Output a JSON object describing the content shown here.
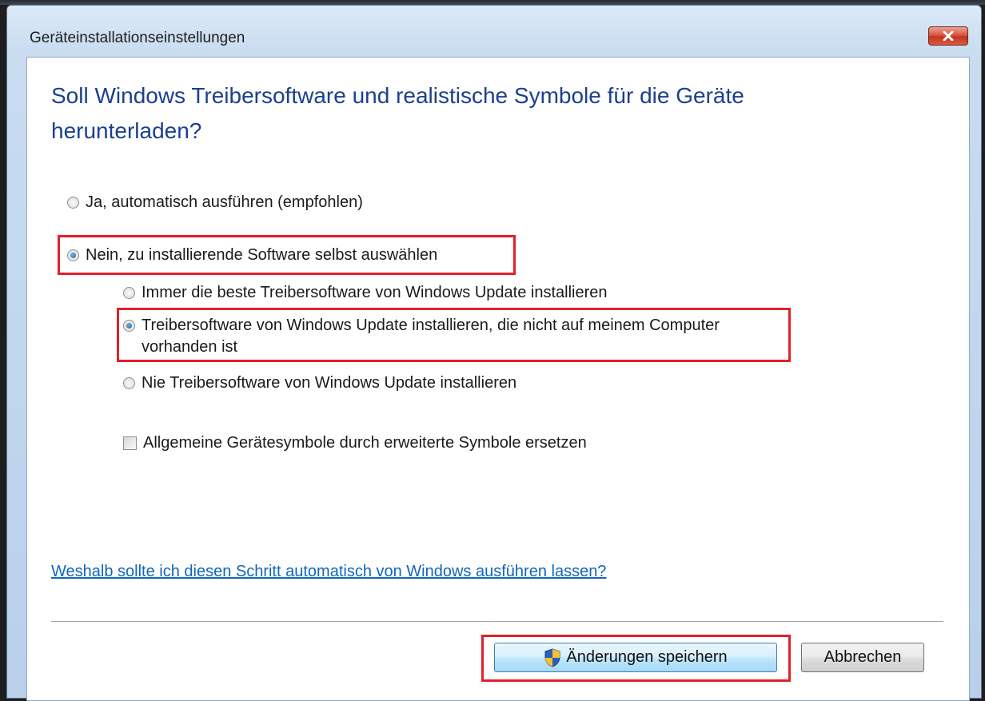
{
  "window": {
    "title": "Geräteinstallationseinstellungen",
    "close_label": "x"
  },
  "heading": "Soll Windows Treibersoftware und realistische Symbole für die Geräte herunterladen?",
  "options": {
    "auto": {
      "label": "Ja, automatisch ausführen (empfohlen)",
      "selected": false
    },
    "manual": {
      "label": "Nein, zu installierende Software selbst auswählen",
      "selected": true
    },
    "sub_options": [
      {
        "label": "Immer die beste Treibersoftware von Windows Update installieren",
        "selected": false
      },
      {
        "label": "Treibersoftware von Windows Update installieren, die nicht auf meinem Computer vorhanden ist",
        "selected": true
      },
      {
        "label": "Nie Treibersoftware von Windows Update installieren",
        "selected": false
      }
    ],
    "icons_checkbox": {
      "label": "Allgemeine Gerätesymbole durch erweiterte Symbole ersetzen",
      "checked": false
    }
  },
  "help_link": "Weshalb sollte ich diesen Schritt automatisch von Windows ausführen lassen?",
  "buttons": {
    "save": "Änderungen speichern",
    "cancel": "Abbrechen"
  },
  "colors": {
    "heading": "#1b3f91",
    "link": "#1166bb",
    "highlight": "#e0202a"
  },
  "icons": {
    "close": "close-icon",
    "shield": "uac-shield-icon"
  }
}
